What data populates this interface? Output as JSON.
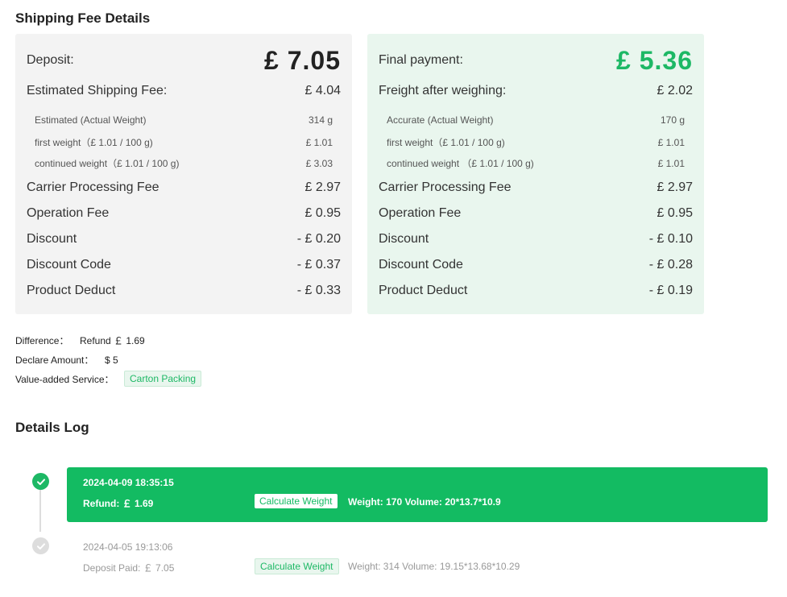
{
  "shipping": {
    "title": "Shipping Fee Details",
    "deposit_card": {
      "head_label": "Deposit:",
      "head_value": "£ 7.05",
      "est_fee_label": "Estimated Shipping Fee:",
      "est_fee_value": "£ 4.04",
      "weight_label": "Estimated (Actual Weight)",
      "weight_value": "314 g",
      "first_weight_label": "first weight（£ 1.01 / 100 g)",
      "first_weight_value": "£ 1.01",
      "cont_weight_label": "continued weight（£ 1.01 / 100 g)",
      "cont_weight_value": "£ 3.03",
      "carrier_label": "Carrier Processing Fee",
      "carrier_value": "£ 2.97",
      "operation_label": "Operation Fee",
      "operation_value": "£ 0.95",
      "discount_label": "Discount",
      "discount_value": "- £ 0.20",
      "discount_code_label": "Discount Code",
      "discount_code_value": "- £ 0.37",
      "product_deduct_label": "Product Deduct",
      "product_deduct_value": "- £ 0.33"
    },
    "final_card": {
      "head_label": "Final payment:",
      "head_value": "£ 5.36",
      "freight_label": "Freight after weighing:",
      "freight_value": "£ 2.02",
      "weight_label": "Accurate (Actual Weight)",
      "weight_value": "170 g",
      "first_weight_label": "first weight（£ 1.01 / 100 g)",
      "first_weight_value": "£ 1.01",
      "cont_weight_label": "continued weight （£ 1.01 / 100 g)",
      "cont_weight_value": "£ 1.01",
      "carrier_label": "Carrier Processing Fee",
      "carrier_value": "£ 2.97",
      "operation_label": "Operation Fee",
      "operation_value": "£ 0.95",
      "discount_label": "Discount",
      "discount_value": "- £ 0.10",
      "discount_code_label": "Discount Code",
      "discount_code_value": "- £ 0.28",
      "product_deduct_label": "Product Deduct",
      "product_deduct_value": "- £ 0.19"
    },
    "difference_label": "Difference：",
    "difference_value": "Refund ￡ 1.69",
    "declare_label": "Declare Amount：",
    "declare_value": "$ 5",
    "vas_label": "Value-added Service：",
    "vas_tag": "Carton Packing"
  },
  "log": {
    "title": "Details Log",
    "entries": [
      {
        "timestamp": "2024-04-09 18:35:15",
        "amount": "Refund: ￡ 1.69",
        "tag": "Calculate Weight",
        "measure": "Weight: 170 Volume: 20*13.7*10.9"
      },
      {
        "timestamp": "2024-04-05 19:13:06",
        "amount": "Deposit Paid: ￡ 7.05",
        "tag": "Calculate Weight",
        "measure": "Weight: 314 Volume: 19.15*13.68*10.29"
      }
    ]
  },
  "colors": {
    "accent_green": "#13bb62",
    "final_card_bg": "#e9f6ee",
    "deposit_card_bg": "#f3f3f3"
  },
  "icons": {
    "done": "check-circle-icon",
    "pending": "check-circle-icon"
  }
}
